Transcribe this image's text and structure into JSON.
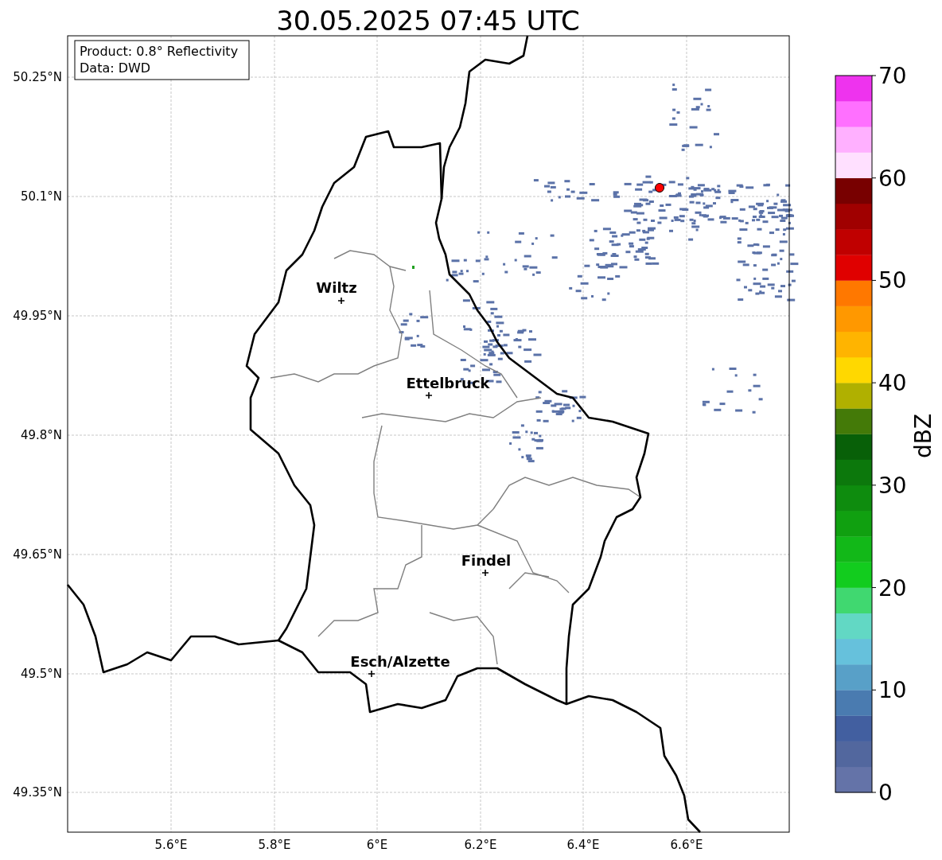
{
  "title": "30.05.2025 07:45 UTC",
  "info_box": {
    "lines": [
      "Product: 0.8° Reflectivity",
      "Data: DWD"
    ]
  },
  "map": {
    "y_ticks": [
      "50.25°N",
      "50.1°N",
      "49.95°N",
      "49.8°N",
      "49.65°N",
      "49.5°N",
      "49.35°N"
    ],
    "x_ticks": [
      "5.6°E",
      "5.8°E",
      "6°E",
      "6.2°E",
      "6.4°E",
      "6.6°E"
    ],
    "cities": [
      {
        "name": "Wiltz"
      },
      {
        "name": "Ettelbruck"
      },
      {
        "name": "Findel"
      },
      {
        "name": "Esch/Alzette"
      }
    ]
  },
  "colorbar": {
    "label": "dBZ",
    "ticks": [
      "70",
      "60",
      "50",
      "40",
      "30",
      "20",
      "10",
      "0"
    ],
    "segments": [
      {
        "color": "#6473a8"
      },
      {
        "color": "#52679e"
      },
      {
        "color": "#425fa0"
      },
      {
        "color": "#4a7bb0"
      },
      {
        "color": "#58a0c8"
      },
      {
        "color": "#66c1dc"
      },
      {
        "color": "#62d8c4"
      },
      {
        "color": "#40d870"
      },
      {
        "color": "#12cc1e"
      },
      {
        "color": "#12b818"
      },
      {
        "color": "#10a010"
      },
      {
        "color": "#0e8c0e"
      },
      {
        "color": "#0c780c"
      },
      {
        "color": "#086008"
      },
      {
        "color": "#447a08"
      },
      {
        "color": "#b0b000"
      },
      {
        "color": "#ffd800"
      },
      {
        "color": "#ffb400"
      },
      {
        "color": "#ff9800"
      },
      {
        "color": "#ff7800"
      },
      {
        "color": "#e00000"
      },
      {
        "color": "#c00000"
      },
      {
        "color": "#a00000"
      },
      {
        "color": "#780000"
      },
      {
        "color": "#ffe0ff"
      },
      {
        "color": "#ffb0ff"
      },
      {
        "color": "#ff70ff"
      },
      {
        "color": "#ee33ee"
      }
    ]
  }
}
